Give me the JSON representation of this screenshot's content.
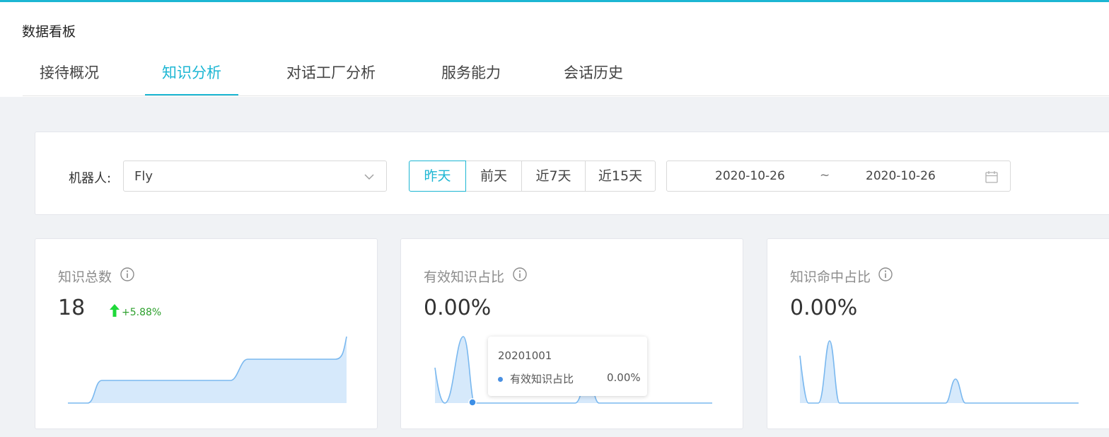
{
  "page": {
    "title": "数据看板"
  },
  "tabs": [
    {
      "label": "接待概况",
      "active": false
    },
    {
      "label": "知识分析",
      "active": true
    },
    {
      "label": "对话工厂分析",
      "active": false
    },
    {
      "label": "服务能力",
      "active": false
    },
    {
      "label": "会话历史",
      "active": false
    }
  ],
  "filters": {
    "robot_label": "机器人:",
    "robot_value": "Fly",
    "ranges": [
      {
        "label": "昨天",
        "active": true
      },
      {
        "label": "前天",
        "active": false
      },
      {
        "label": "近7天",
        "active": false
      },
      {
        "label": "近15天",
        "active": false
      }
    ],
    "date_start": "2020-10-26",
    "date_sep": "~",
    "date_end": "2020-10-26"
  },
  "metrics": [
    {
      "title": "知识总数",
      "value": "18",
      "trend": "+5.88%",
      "trend_direction": "up"
    },
    {
      "title": "有效知识占比",
      "value": "0.00%"
    },
    {
      "title": "知识命中占比",
      "value": "0.00%"
    }
  ],
  "tooltip": {
    "date": "20201001",
    "series_label": "有效知识占比",
    "value": "0.00%"
  },
  "colors": {
    "accent": "#1cb6d3",
    "trend_up": "#1fd93a",
    "spark_line": "#7ab8ef",
    "spark_fill": "#d6e9fb",
    "marker": "#3d8fe6"
  },
  "icons": {
    "info": "info-circle-icon",
    "dropdown": "chevron-down-icon",
    "calendar": "calendar-icon",
    "trend": "arrow-up-icon"
  }
}
